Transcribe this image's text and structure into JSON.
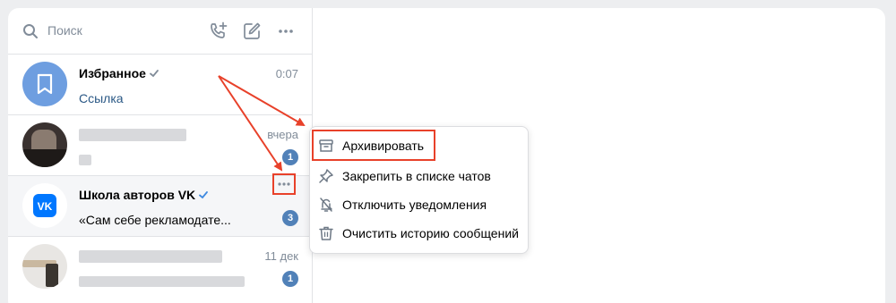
{
  "search": {
    "placeholder": "Поиск"
  },
  "toolbar": {
    "icons": [
      "search-icon",
      "add-call-icon",
      "compose-icon",
      "more-dots-icon"
    ]
  },
  "chats": [
    {
      "title": "Избранное",
      "verified": true,
      "time": "0:07",
      "message": "Ссылка",
      "avatar": "bookmark-icon"
    },
    {
      "title": "",
      "time": "вчера",
      "unread": "1"
    },
    {
      "title": "Школа авторов VK",
      "verified": true,
      "message": "«Сам себе рекламодате...",
      "unread": "3",
      "avatar": "vk-logo-icon"
    },
    {
      "title": "",
      "time": "11 дек",
      "unread": "1"
    }
  ],
  "context_menu": {
    "items": [
      {
        "label": "Архивировать",
        "icon": "archive-icon"
      },
      {
        "label": "Закрепить в списке чатов",
        "icon": "pin-icon"
      },
      {
        "label": "Отключить уведомления",
        "icon": "bell-off-icon"
      },
      {
        "label": "Очистить историю сообщений",
        "icon": "trash-icon"
      }
    ]
  },
  "colors": {
    "accent": "#5181b8",
    "annotation": "#e8412a",
    "link": "#2a5885"
  }
}
